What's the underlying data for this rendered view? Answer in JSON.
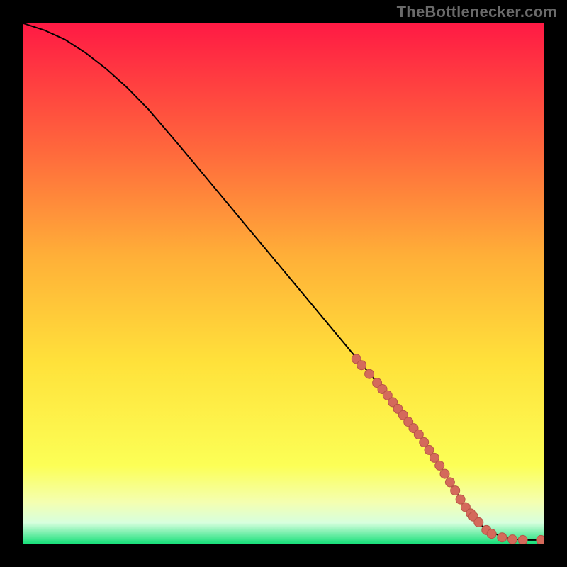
{
  "watermark": "TheBottlenecker.com",
  "colors": {
    "bg_black": "#000000",
    "grad_top": "#ff1a44",
    "grad_mid1": "#ff6a3c",
    "grad_mid2": "#ffb038",
    "grad_mid3": "#ffe13a",
    "grad_f2": "#fcff56",
    "grad_f1": "#f4ffb0",
    "grad_f0": "#d7ffde",
    "grad_base": "#18e07a",
    "line": "#000000",
    "marker_fill": "#d46a5b",
    "marker_stroke": "#b85447"
  },
  "chart_data": {
    "type": "line",
    "title": "",
    "xlabel": "",
    "ylabel": "",
    "xlim": [
      0,
      100
    ],
    "ylim": [
      0,
      100
    ],
    "series": [
      {
        "name": "curve",
        "x": [
          0,
          4,
          8,
          12,
          16,
          20,
          24,
          30,
          40,
          50,
          60,
          70,
          76,
          80,
          83,
          85,
          88,
          92,
          96,
          100
        ],
        "y": [
          100,
          98.7,
          96.9,
          94.3,
          91.2,
          87.6,
          83.5,
          76.5,
          64.5,
          52.5,
          40.5,
          28.5,
          21.0,
          15.0,
          10.2,
          7.0,
          3.5,
          1.2,
          0.7,
          0.7
        ]
      }
    ],
    "markers": {
      "name": "highlight-points",
      "x": [
        64,
        65,
        66.5,
        68,
        69,
        70,
        71,
        72,
        73,
        74,
        75,
        76,
        77,
        78,
        79,
        80,
        81,
        82,
        83,
        84,
        85,
        86,
        86.5,
        87.5,
        89,
        90,
        92,
        94,
        96,
        99.5
      ],
      "y": [
        35.5,
        34.3,
        32.6,
        30.9,
        29.7,
        28.5,
        27.2,
        25.9,
        24.7,
        23.4,
        22.2,
        21.0,
        19.5,
        18.0,
        16.5,
        15.0,
        13.4,
        11.8,
        10.2,
        8.5,
        7.0,
        5.8,
        5.2,
        4.1,
        2.6,
        1.9,
        1.2,
        0.8,
        0.7,
        0.7
      ]
    }
  }
}
